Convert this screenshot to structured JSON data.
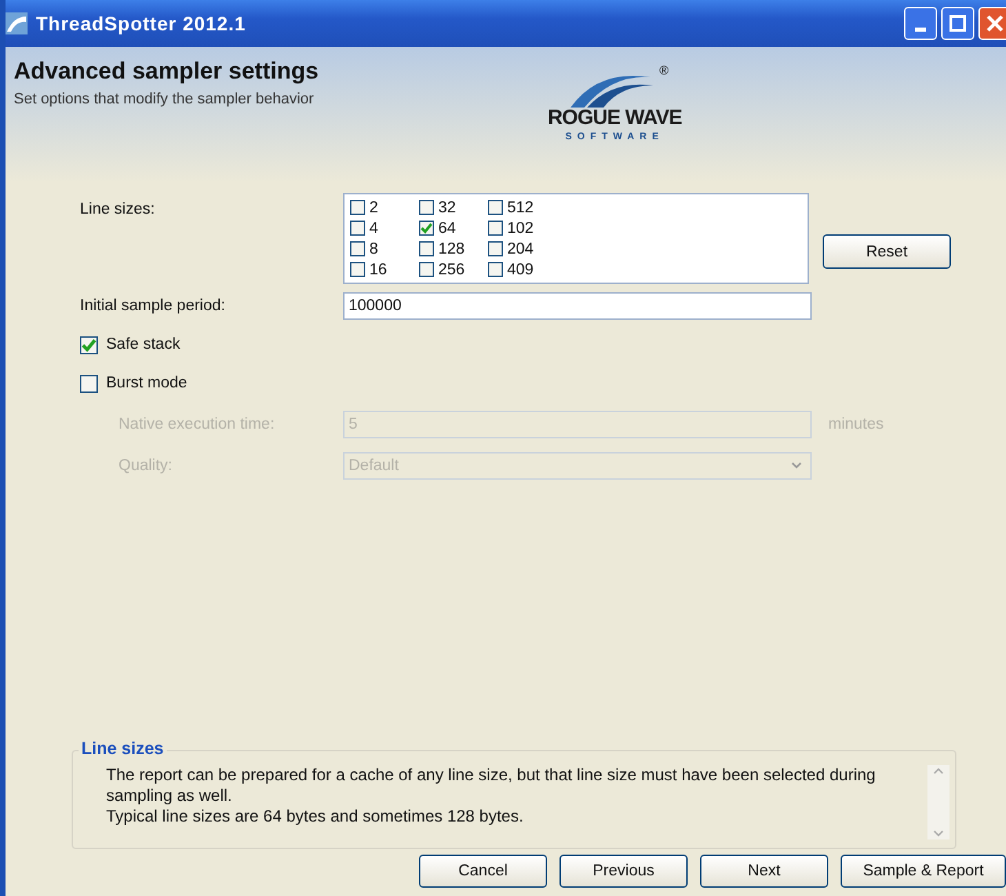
{
  "window": {
    "title": "ThreadSpotter 2012.1"
  },
  "header": {
    "title": "Advanced sampler settings",
    "subtitle": "Set options that modify the sampler behavior",
    "logo": {
      "name": "ROGUE WAVE",
      "tagline": "SOFTWARE",
      "mark": "®"
    }
  },
  "line_sizes": {
    "label": "Line sizes:",
    "options": [
      {
        "label": "2",
        "checked": false
      },
      {
        "label": "4",
        "checked": false
      },
      {
        "label": "8",
        "checked": false
      },
      {
        "label": "16",
        "checked": false
      },
      {
        "label": "32",
        "checked": false
      },
      {
        "label": "64",
        "checked": true
      },
      {
        "label": "128",
        "checked": false
      },
      {
        "label": "256",
        "checked": false
      },
      {
        "label": "512",
        "checked": false
      },
      {
        "label": "102",
        "checked": false
      },
      {
        "label": "204",
        "checked": false
      },
      {
        "label": "409",
        "checked": false
      }
    ],
    "reset_button": "Reset"
  },
  "initial_sample_period": {
    "label": "Initial sample period:",
    "value": "100000"
  },
  "options": [
    {
      "label": "Safe stack",
      "checked": true
    },
    {
      "label": "Burst mode",
      "checked": false
    }
  ],
  "native_execution_time": {
    "label": "Native execution time:",
    "value": "5",
    "unit": "minutes",
    "disabled": true
  },
  "quality": {
    "label": "Quality:",
    "value": "Default",
    "disabled": true
  },
  "help": {
    "title": "Line sizes",
    "lines": [
      "The report can be prepared for a cache of any line size, but that line size must have been selected during sampling as well.",
      "Typical line sizes are 64 bytes and sometimes 128 bytes."
    ]
  },
  "buttons": [
    "Cancel",
    "Previous",
    "Next",
    "Sample & Report"
  ]
}
